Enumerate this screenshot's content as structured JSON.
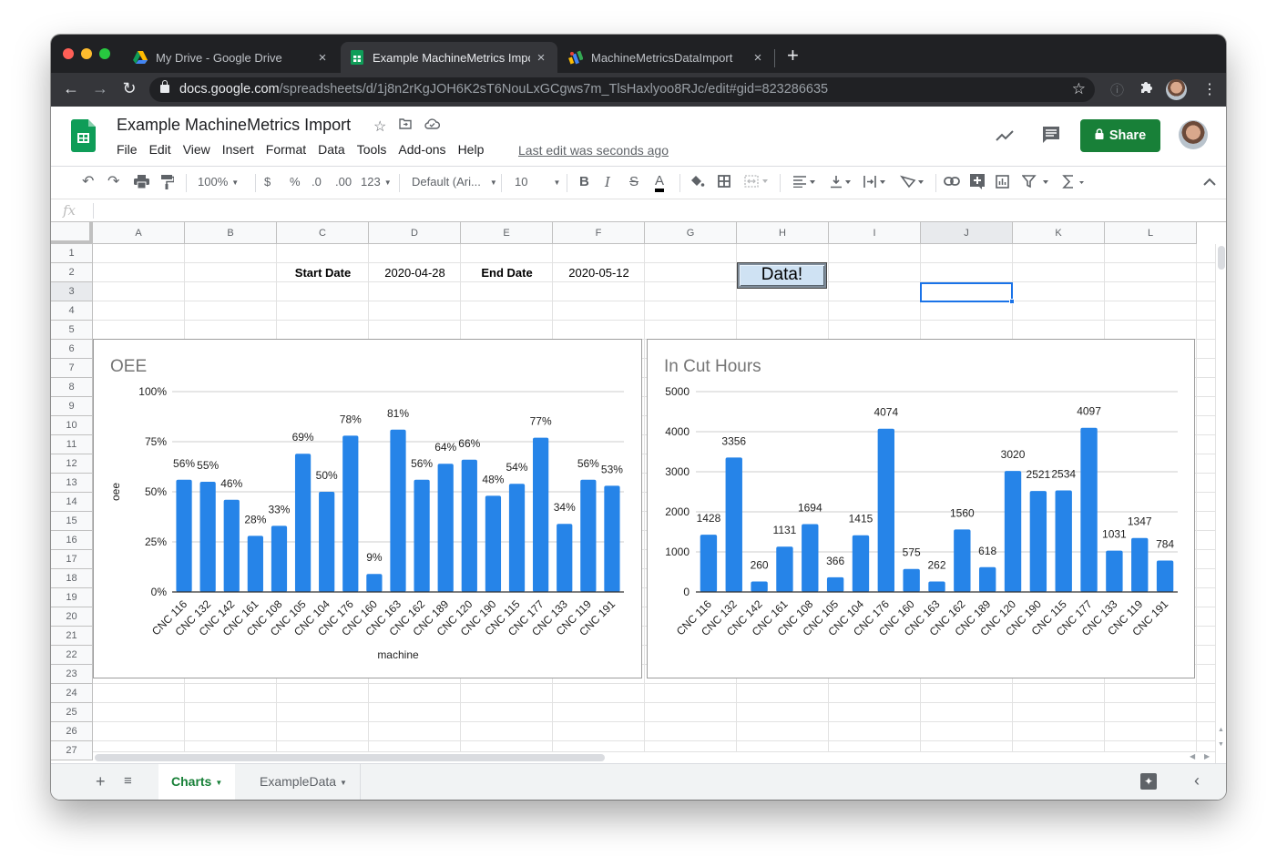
{
  "browser": {
    "tabs": [
      {
        "title": "My Drive - Google Drive",
        "icon": "google-drive-icon",
        "active": false
      },
      {
        "title": "Example MachineMetrics Impor",
        "icon": "google-sheets-icon",
        "active": true
      },
      {
        "title": "MachineMetricsDataImport",
        "icon": "apps-script-icon",
        "active": false
      }
    ],
    "new_tab": "+",
    "close": "×",
    "url_host": "docs.google.com",
    "url_path": "/spreadsheets/d/1j8n2rKgJOH6K2sT6NouLxGCgws7m_TlsHaxlyoo8RJc/edit#gid=823286635"
  },
  "header": {
    "title": "Example MachineMetrics Import",
    "menu": [
      "File",
      "Edit",
      "View",
      "Insert",
      "Format",
      "Data",
      "Tools",
      "Add-ons",
      "Help"
    ],
    "last_edit": "Last edit was seconds ago",
    "share_label": "Share"
  },
  "toolbar": {
    "zoom": "100%",
    "currency": "$",
    "percent": "%",
    "dec_decrease": ".0",
    "dec_increase": ".00",
    "more_formats": "123",
    "font": "Default (Ari...",
    "font_size": "10",
    "bold": "B",
    "italic": "I",
    "strike": "S",
    "text_color": "A"
  },
  "formula_bar": {
    "fx": "fx",
    "value": ""
  },
  "grid": {
    "columns": [
      "A",
      "B",
      "C",
      "D",
      "E",
      "F",
      "G",
      "H",
      "I",
      "J",
      "K",
      "L"
    ],
    "selected_column": "J",
    "rows": [
      "1",
      "2",
      "3",
      "4",
      "5",
      "6",
      "7",
      "8",
      "9",
      "10",
      "11",
      "12",
      "13",
      "14",
      "15",
      "16",
      "17",
      "18",
      "19",
      "20",
      "21",
      "22",
      "23",
      "24",
      "25",
      "26",
      "27"
    ],
    "selected_row": "3",
    "cells": {
      "C2": "Start Date",
      "D2": "2020-04-28",
      "E2": "End Date",
      "F2": "2020-05-12"
    },
    "data_button": "Data!"
  },
  "chart_data": [
    {
      "type": "bar",
      "title": "OEE",
      "xlabel": "machine",
      "ylabel": "oee",
      "ylim": [
        0,
        1
      ],
      "yticks": [
        "0%",
        "25%",
        "50%",
        "75%",
        "100%"
      ],
      "grid": true,
      "color": "#2684e8",
      "categories": [
        "CNC 116",
        "CNC 132",
        "CNC 142",
        "CNC 161",
        "CNC 108",
        "CNC 105",
        "CNC 104",
        "CNC 176",
        "CNC 160",
        "CNC 163",
        "CNC 162",
        "CNC 189",
        "CNC 120",
        "CNC 190",
        "CNC 115",
        "CNC 177",
        "CNC 133",
        "CNC 119",
        "CNC 191"
      ],
      "values": [
        0.56,
        0.55,
        0.46,
        0.28,
        0.33,
        0.69,
        0.5,
        0.78,
        0.09,
        0.81,
        0.56,
        0.64,
        0.66,
        0.48,
        0.54,
        0.77,
        0.34,
        0.56,
        0.53
      ],
      "labels": [
        "56%",
        "55%",
        "46%",
        "28%",
        "33%",
        "69%",
        "50%",
        "78%",
        "9%",
        "81%",
        "56%",
        "64%",
        "66%",
        "48%",
        "54%",
        "77%",
        "34%",
        "56%",
        "53%"
      ]
    },
    {
      "type": "bar",
      "title": "In Cut Hours",
      "xlabel": "",
      "ylabel": "",
      "ylim": [
        0,
        5000
      ],
      "yticks": [
        "0",
        "1000",
        "2000",
        "3000",
        "4000",
        "5000"
      ],
      "grid": true,
      "color": "#2684e8",
      "categories": [
        "CNC 116",
        "CNC 132",
        "CNC 142",
        "CNC 161",
        "CNC 108",
        "CNC 105",
        "CNC 104",
        "CNC 176",
        "CNC 160",
        "CNC 163",
        "CNC 162",
        "CNC 189",
        "CNC 120",
        "CNC 190",
        "CNC 115",
        "CNC 177",
        "CNC 133",
        "CNC 119",
        "CNC 191"
      ],
      "values": [
        1428,
        3356,
        260,
        1131,
        1694,
        366,
        1415,
        4074,
        575,
        262,
        1560,
        618,
        3020,
        2521,
        2534,
        4097,
        1031,
        1347,
        784
      ],
      "labels": [
        "1428",
        "3356",
        "260",
        "1131",
        "1694",
        "366",
        "1415",
        "4074",
        "575",
        "262",
        "1560",
        "618",
        "3020",
        "2521",
        "2534",
        "4097",
        "1031",
        "1347",
        "784"
      ]
    }
  ],
  "sheet_tabs": [
    {
      "label": "Charts",
      "active": true
    },
    {
      "label": "ExampleData",
      "active": false
    }
  ],
  "colors": {
    "share_green": "#188038",
    "bar_blue": "#2684e8",
    "selection_blue": "#1a73e8"
  }
}
